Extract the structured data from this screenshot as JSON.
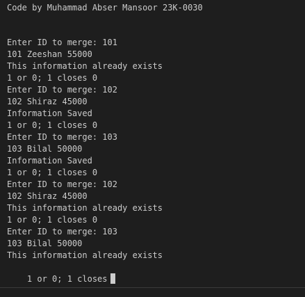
{
  "header": "Code by Muhammad Abser Mansoor 23K-0030",
  "output_lines": [
    "Enter ID to merge: 101",
    "101 Zeeshan 55000",
    "This information already exists",
    "1 or 0; 1 closes 0",
    "Enter ID to merge: 102",
    "102 Shiraz 45000",
    "Information Saved",
    "1 or 0; 1 closes 0",
    "Enter ID to merge: 103",
    "103 Bilal 50000",
    "Information Saved",
    "1 or 0; 1 closes 0",
    "Enter ID to merge: 102",
    "102 Shiraz 45000",
    "This information already exists",
    "1 or 0; 1 closes 0",
    "Enter ID to merge: 103",
    "103 Bilal 50000",
    "This information already exists"
  ],
  "prompt_line": "1 or 0; 1 closes"
}
